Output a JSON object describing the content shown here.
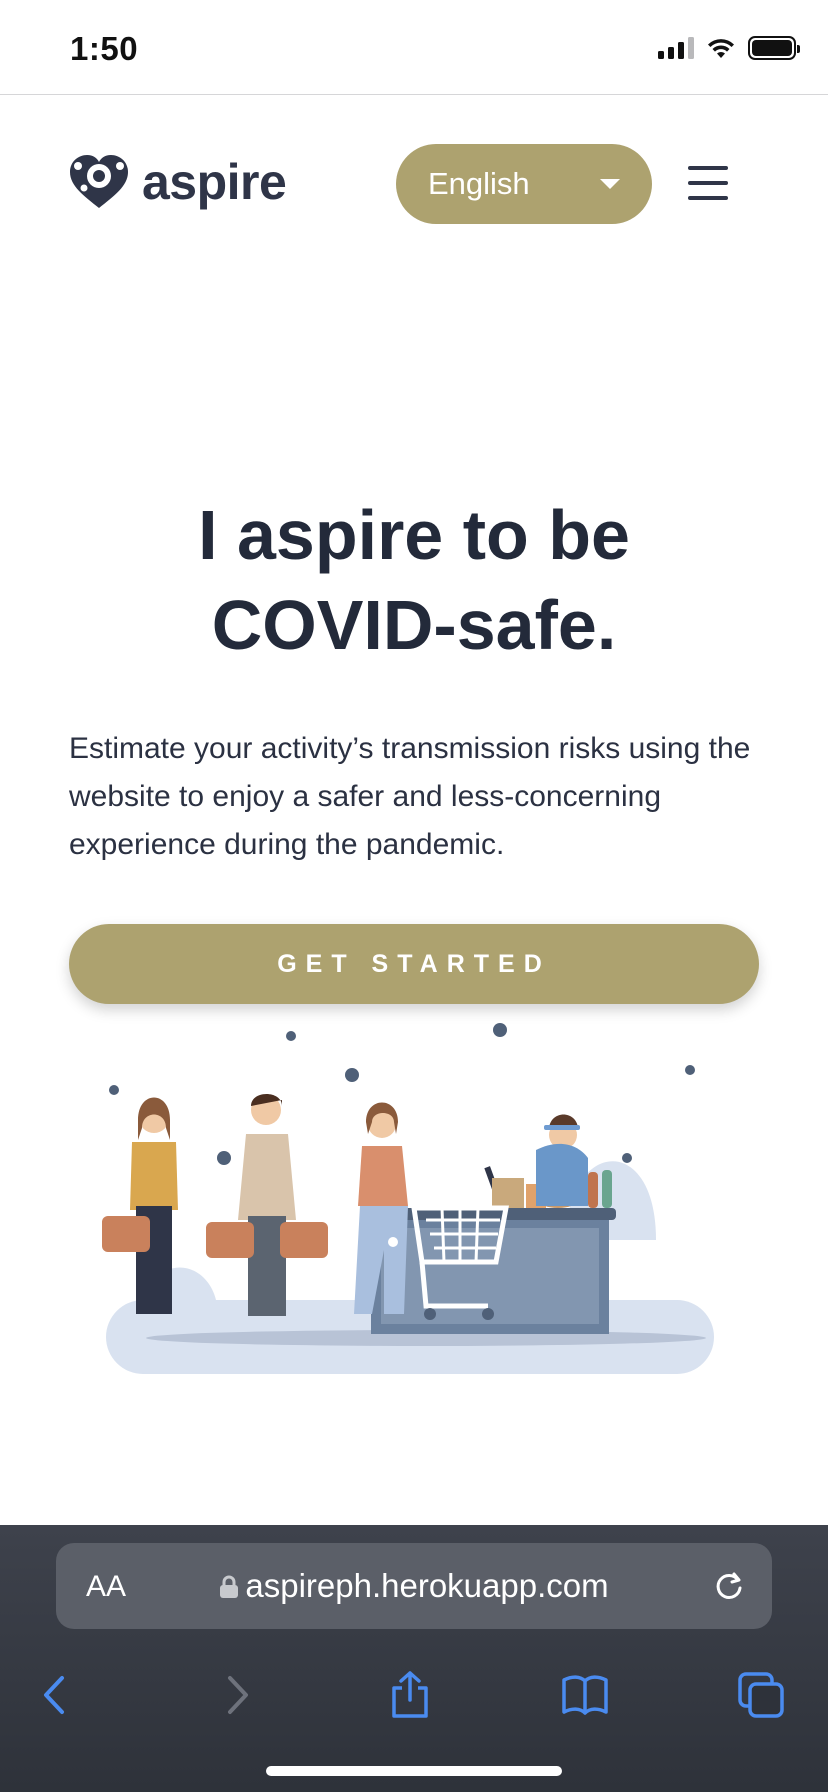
{
  "status_bar": {
    "time": "1:50",
    "icons": [
      "signal-icon",
      "wifi-icon",
      "battery-icon"
    ]
  },
  "header": {
    "logo_text": "aspire",
    "language": {
      "selected": "English"
    },
    "menu_icon": "hamburger-menu-icon"
  },
  "hero": {
    "title_prefix": "I ",
    "title_bold": "aspire",
    "title_suffix": " to be",
    "title_line2": "COVID-safe.",
    "description": "Estimate your activity’s transmission risks using the website to enjoy a safer and less-concerning experience during the pandemic.",
    "cta_label": "GET STARTED"
  },
  "browser": {
    "text_size_label": "AA",
    "url": "aspireph.herokuapp.com",
    "toolbar_icons": [
      "back-icon",
      "forward-icon",
      "share-icon",
      "bookmarks-icon",
      "tabs-icon"
    ]
  },
  "colors": {
    "accent": "#ada26f",
    "text": "#232a3a",
    "browser_bar": "#3e424c",
    "link_blue": "#4a8bf0"
  }
}
